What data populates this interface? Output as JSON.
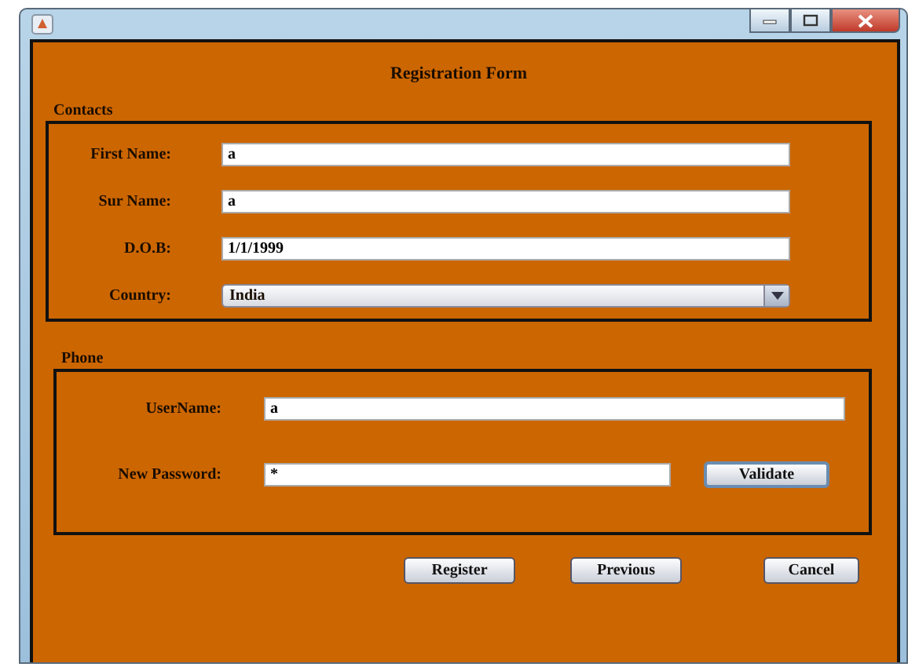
{
  "form": {
    "title": "Registration Form"
  },
  "contacts": {
    "title": "Contacts",
    "fields": [
      {
        "kind": "text",
        "label": "First Name:",
        "value": "a"
      },
      {
        "kind": "text",
        "label": "Sur Name:",
        "value": "a"
      },
      {
        "kind": "text",
        "label": "D.O.B:",
        "value": "1/1/1999"
      },
      {
        "kind": "dropdown",
        "label": "Country:",
        "value": "India"
      }
    ]
  },
  "phone": {
    "title": "Phone",
    "username": {
      "label": "UserName:",
      "value": "a"
    },
    "password": {
      "label": "New Password:",
      "value": "*"
    },
    "validate_button": "Validate"
  },
  "buttons": [
    "Register",
    "Previous",
    "Cancel"
  ]
}
